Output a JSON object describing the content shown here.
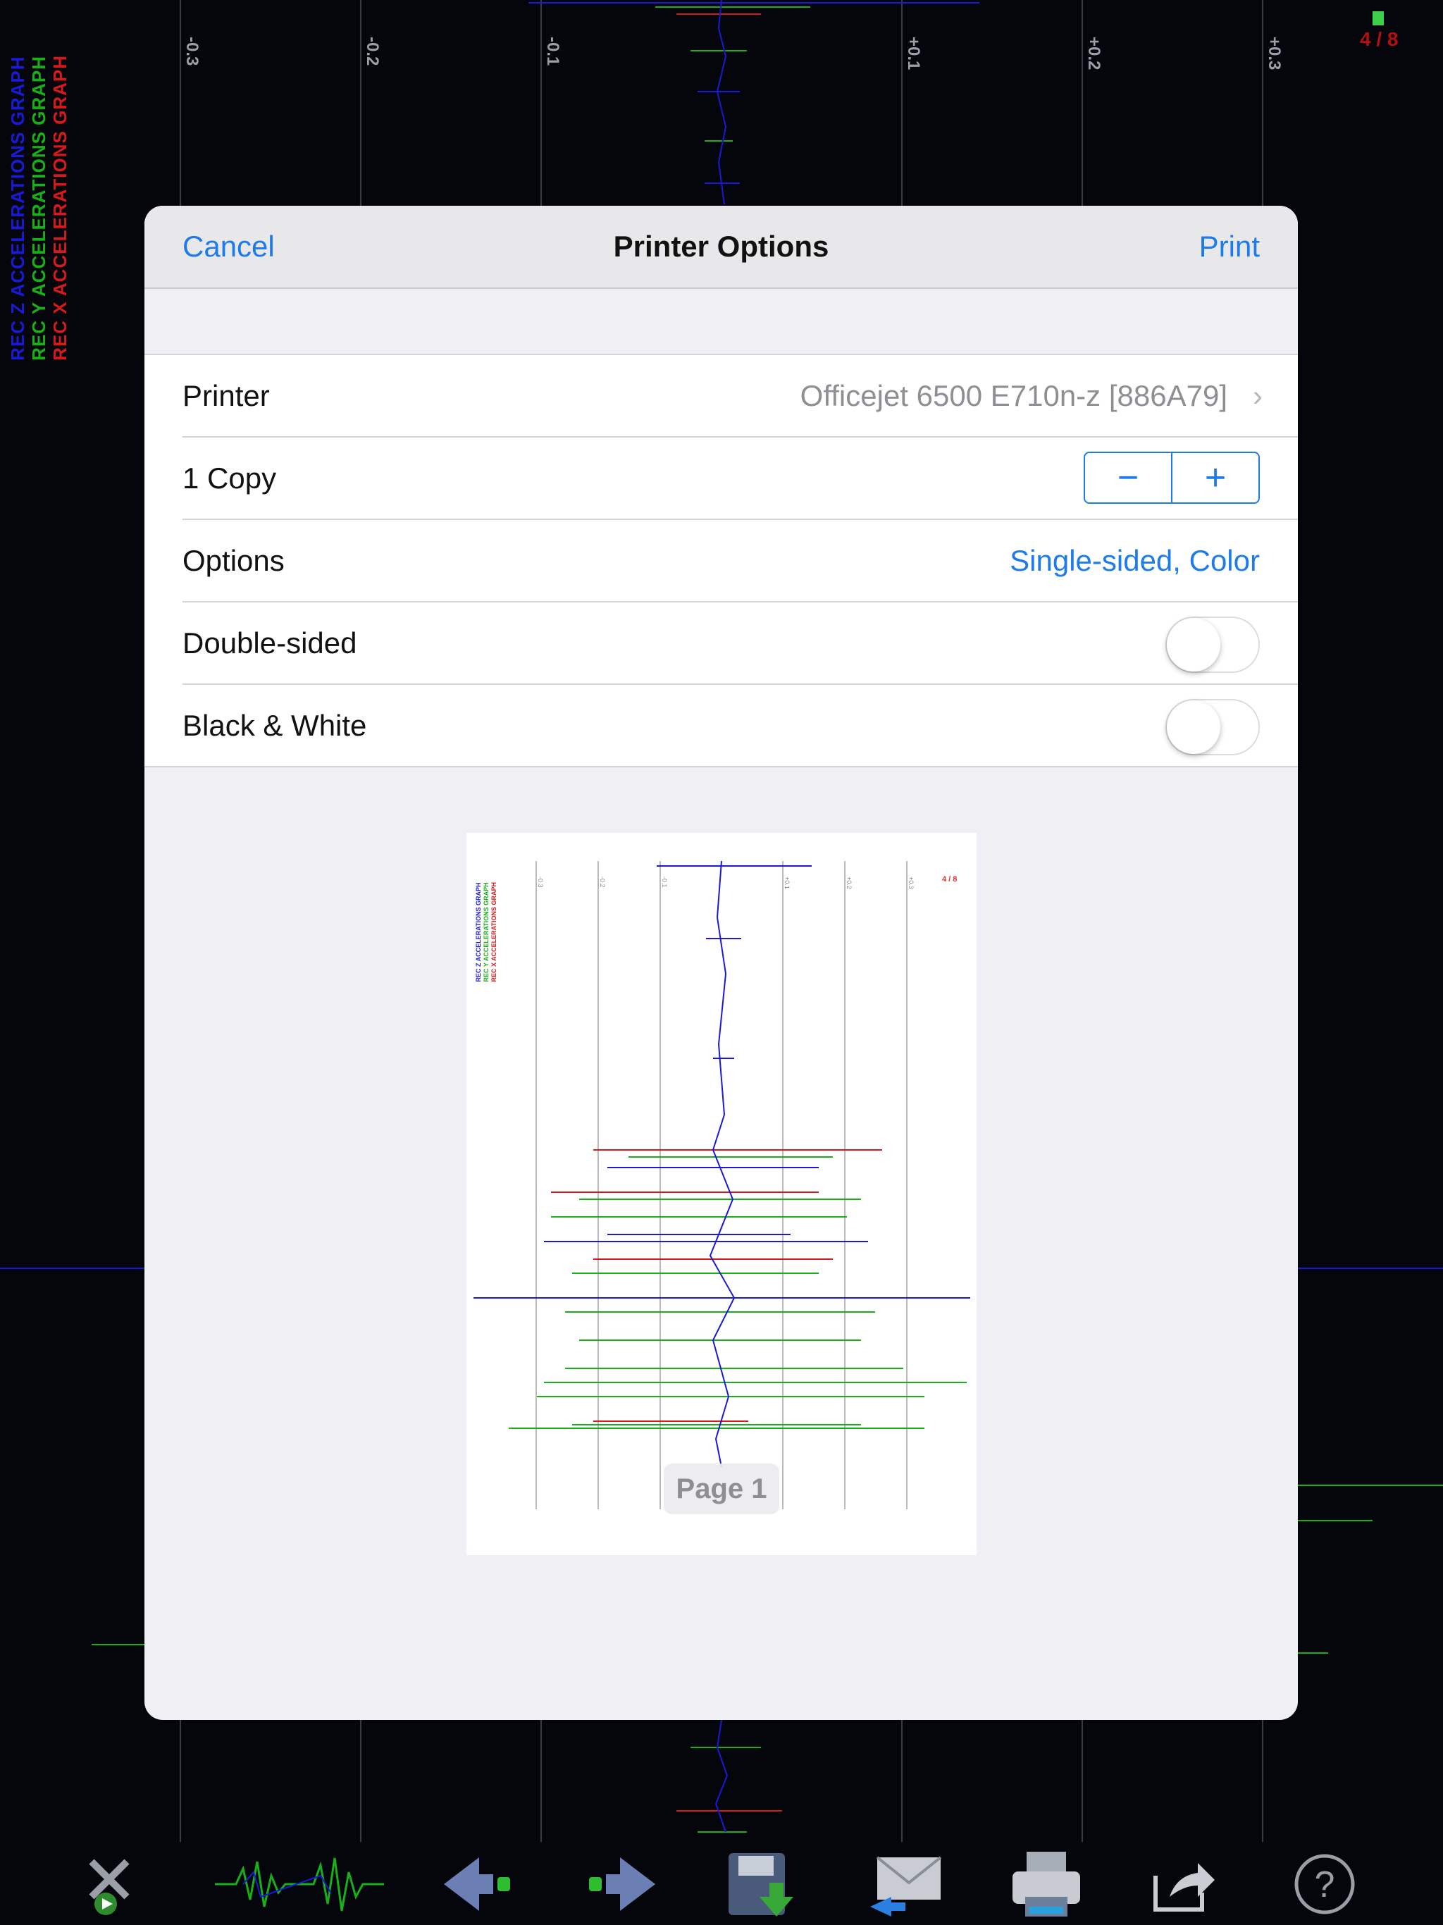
{
  "status": {
    "left": "",
    "right": "",
    "page_counter": "4 / 8"
  },
  "graph_labels": {
    "x": "REC X ACCELERATIONS GRAPH",
    "y": "REC Y ACCELERATIONS GRAPH",
    "z": "REC Z ACCELERATIONS GRAPH"
  },
  "axis_ticks": [
    "-0.3",
    "-0.2",
    "-0.1",
    "+0.1",
    "+0.2",
    "+0.3"
  ],
  "colors": {
    "accent": "#1d7bec",
    "x_series": "#d61a1a",
    "y_series": "#18b018",
    "z_series": "#1a1ad6"
  },
  "dialog": {
    "cancel_label": "Cancel",
    "title": "Printer Options",
    "print_label": "Print",
    "printer": {
      "label": "Printer",
      "value": "Officejet 6500 E710n-z [886A79]"
    },
    "copies": {
      "label": "1 Copy",
      "minus": "−",
      "plus": "+"
    },
    "options": {
      "label": "Options",
      "value": "Single-sided, Color"
    },
    "double_sided": {
      "label": "Double-sided",
      "on": false
    },
    "black_white": {
      "label": "Black & White",
      "on": false
    },
    "preview": {
      "page_label": "Page 1",
      "counter": "4 / 8"
    }
  },
  "toolbar": {
    "items": [
      "tools-icon",
      "waveform-icon",
      "previous-icon",
      "next-icon",
      "save-icon",
      "mail-icon",
      "printer-icon",
      "share-icon",
      "help-icon"
    ]
  }
}
